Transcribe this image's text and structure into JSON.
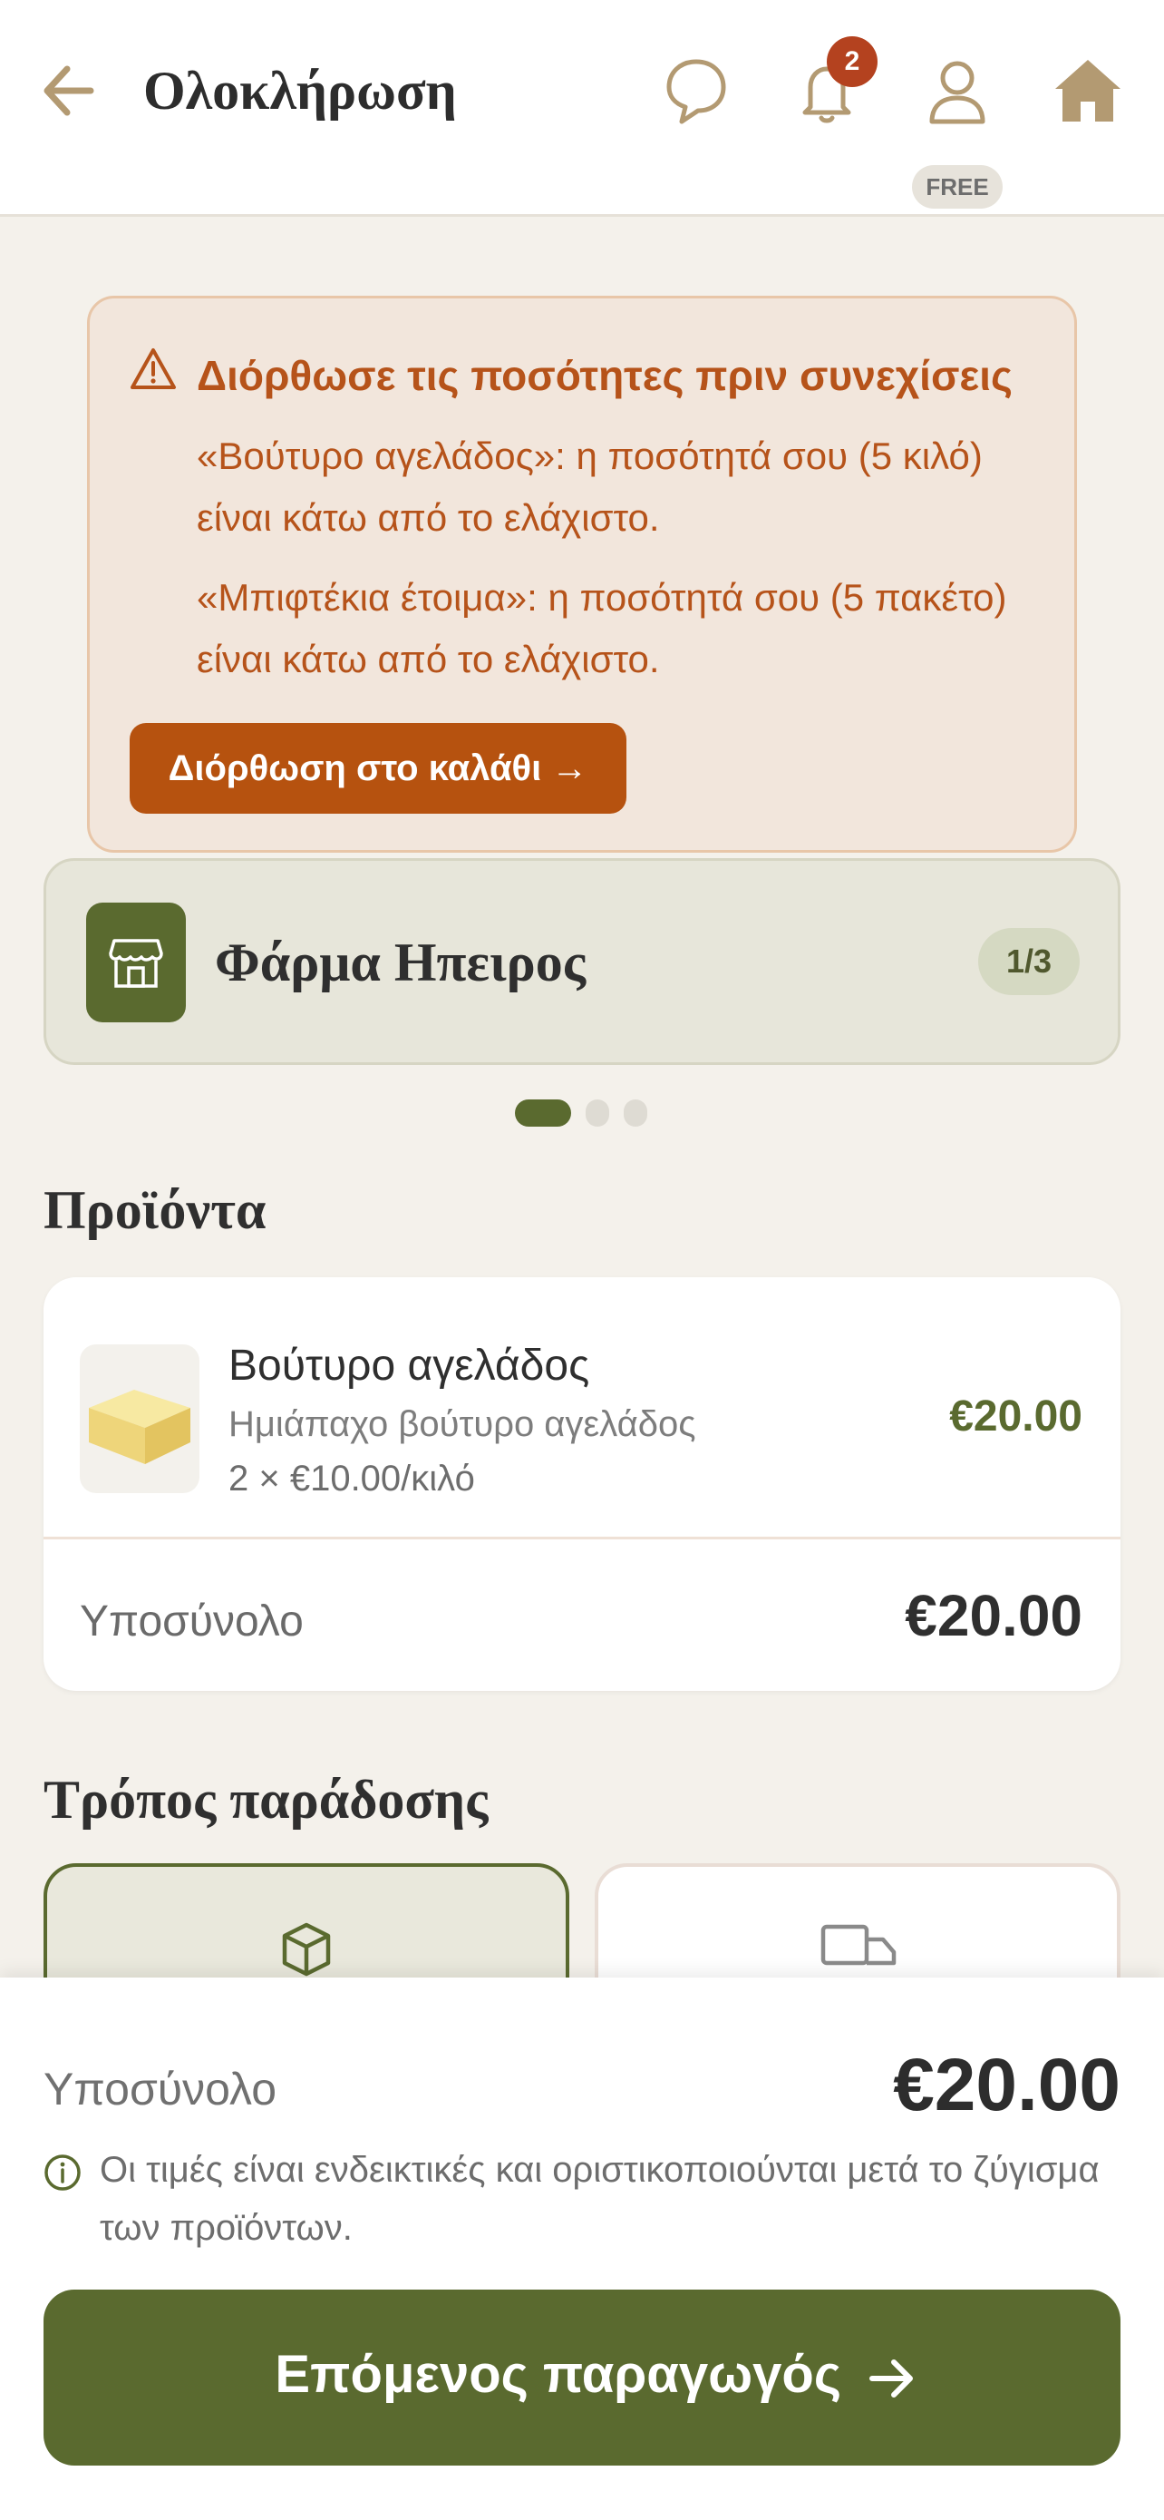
{
  "header": {
    "title": "Ολοκλήρωση",
    "notification_count": "2",
    "plan_badge": "FREE"
  },
  "alert": {
    "title": "Διόρθωσε τις ποσότητες πριν συνεχίσεις",
    "messages": [
      "«Βούτυρο αγελάδος»: η ποσότητά σου (5 κιλό) είναι κάτω από το ελάχιστο.",
      "«Μπιφτέκια έτοιμα»: η ποσότητά σου (5 πακέτο) είναι κάτω από το ελάχιστο."
    ],
    "button": "Διόρθωση στο καλάθι →"
  },
  "producer": {
    "name": "Φάρμα Ηπειρος",
    "pager": "1/3"
  },
  "products": {
    "section_title": "Προϊόντα",
    "items": [
      {
        "name": "Βούτυρο αγελάδος",
        "description": "Ημιάπαχο βούτυρο αγελάδος",
        "quantity": "2 × €10.00/κιλό",
        "price": "€20.00"
      }
    ],
    "subtotal_label": "Υποσύνολο",
    "subtotal_value": "€20.00"
  },
  "delivery": {
    "section_title": "Τρόπος παράδοσης"
  },
  "footer": {
    "subtotal_label": "Υποσύνολο",
    "subtotal_value": "€20.00",
    "info_text": "Οι τιμές είναι ενδεικτικές και οριστικοποιούνται μετά το ζύγισμα των προϊόντων.",
    "next_button": "Επόμενος παραγωγός"
  },
  "colors": {
    "accent_green": "#5a6a2f",
    "warning_orange": "#b6520f",
    "badge_red": "#b4421f",
    "icon_tan": "#b39a72"
  }
}
